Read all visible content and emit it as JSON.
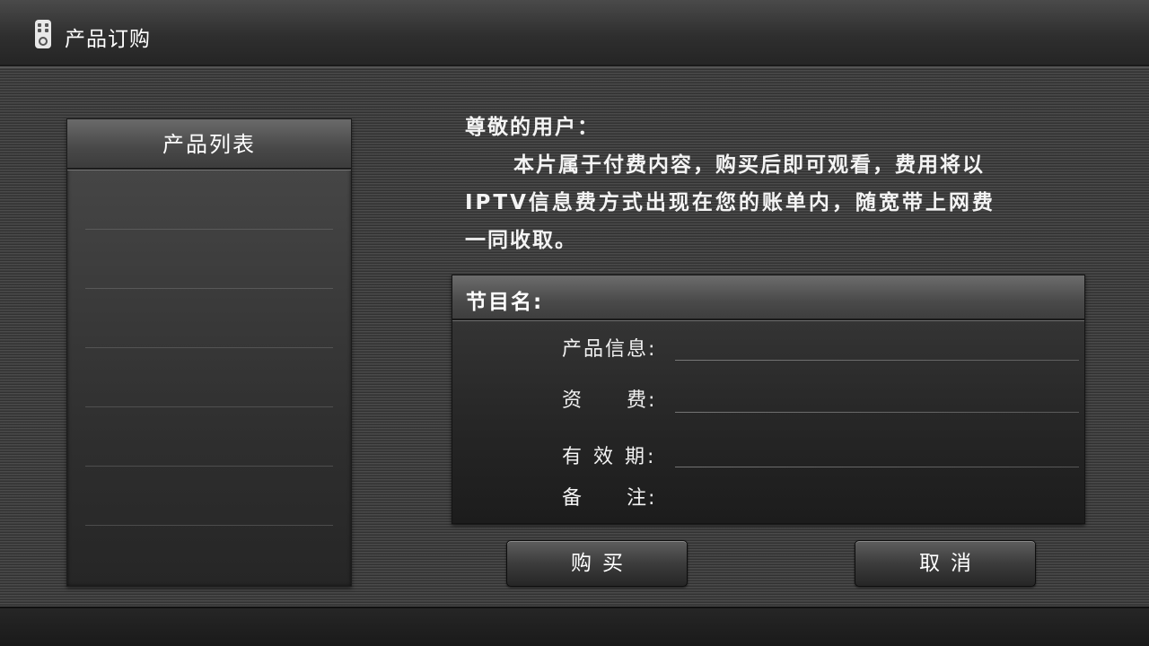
{
  "header": {
    "title": "产品订购",
    "icon": "remote-control-icon"
  },
  "product_list": {
    "title": "产品列表",
    "items": []
  },
  "notice": {
    "greeting": "尊敬的用户：",
    "lines": [
      "本片属于付费内容，购买后即可观看，费用将以",
      "IPTV信息费方式出现在您的账单内，随宽带上网费",
      "一同收取。"
    ]
  },
  "info": {
    "program_label": "节目名:",
    "fields": {
      "product_info": "产品信息:",
      "fee": "资　　费:",
      "validity": "有 效 期:",
      "remark": "备　　注:"
    }
  },
  "buttons": {
    "buy": "购买",
    "cancel": "取消"
  }
}
